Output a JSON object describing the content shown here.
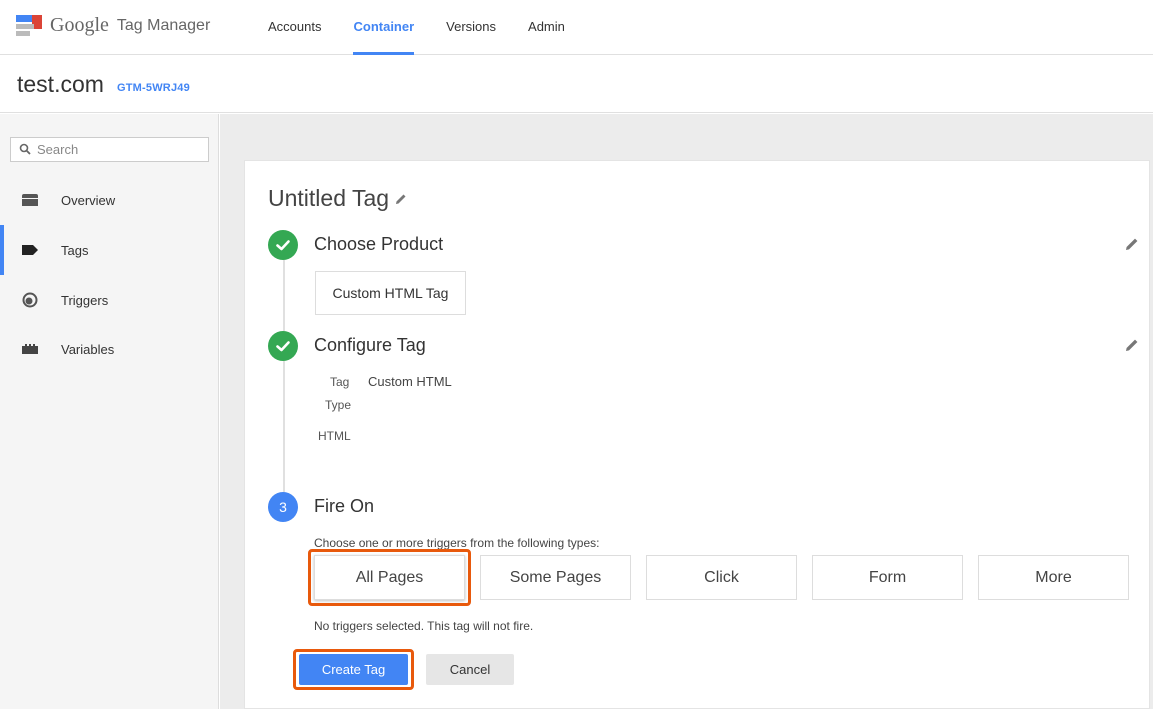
{
  "app": {
    "logo_google": "Google",
    "logo_product": "Tag Manager"
  },
  "topnav": {
    "items": [
      {
        "label": "Accounts"
      },
      {
        "label": "Container",
        "active": true
      },
      {
        "label": "Versions"
      },
      {
        "label": "Admin"
      }
    ]
  },
  "container": {
    "name": "test.com",
    "id": "GTM-5WRJ49"
  },
  "sidebar": {
    "search_placeholder": "Search",
    "items": [
      {
        "label": "Overview",
        "icon": "folder-icon"
      },
      {
        "label": "Tags",
        "icon": "tag-icon",
        "active": true
      },
      {
        "label": "Triggers",
        "icon": "trigger-icon"
      },
      {
        "label": "Variables",
        "icon": "variables-icon"
      }
    ]
  },
  "tag": {
    "title": "Untitled Tag",
    "steps": {
      "product": {
        "title": "Choose Product",
        "value": "Custom HTML Tag"
      },
      "configure": {
        "title": "Configure Tag",
        "tag_type_label_1": "Tag",
        "tag_type_label_2": "Type",
        "tag_type_value": "Custom HTML",
        "html_label": "HTML"
      },
      "fire_on": {
        "number": "3",
        "title": "Fire On",
        "hint": "Choose one or more triggers from the following types:",
        "triggers": [
          "All Pages",
          "Some Pages",
          "Click",
          "Form",
          "More"
        ],
        "status": "No triggers selected. This tag will not fire."
      }
    },
    "actions": {
      "create": "Create Tag",
      "cancel": "Cancel"
    }
  },
  "colors": {
    "accent": "#4285f4",
    "done": "#34a853",
    "highlight": "#e8590c"
  }
}
